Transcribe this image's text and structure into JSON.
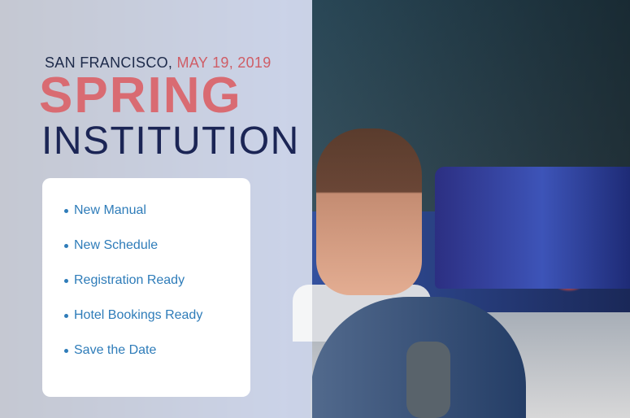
{
  "header": {
    "city": "SAN FRANCISCO,",
    "date": "MAY 19, 2019",
    "title_line1": "SPRING",
    "title_line2": "INSTITUTION"
  },
  "features": [
    "New Manual",
    "New Schedule",
    "Registration Ready",
    "Hotel Bookings Ready",
    "Save the Date"
  ],
  "colors": {
    "accent": "#d96b72",
    "navy": "#1b2555",
    "link": "#2e7cb9"
  }
}
